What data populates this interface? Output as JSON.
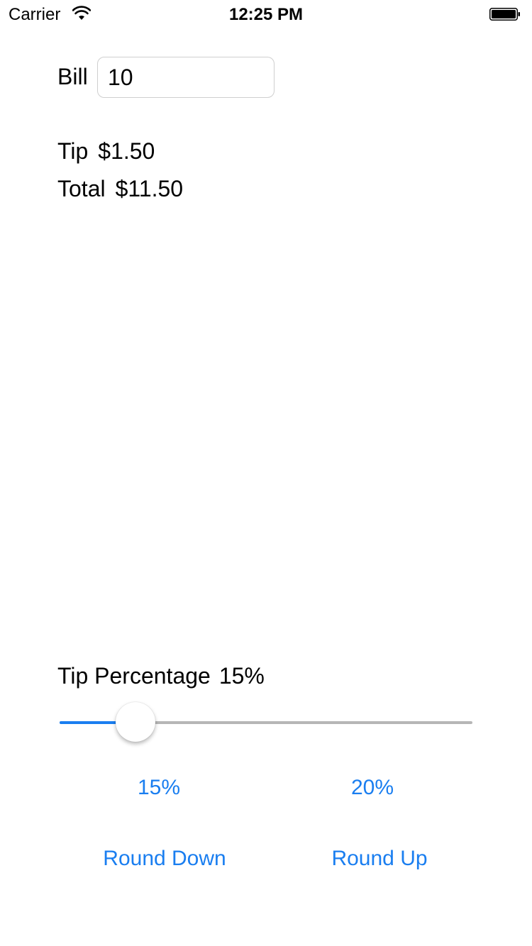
{
  "status_bar": {
    "carrier": "Carrier",
    "time": "12:25 PM"
  },
  "bill": {
    "label": "Bill",
    "value": "10"
  },
  "tip": {
    "label": "Tip",
    "value": "$1.50"
  },
  "total": {
    "label": "Total",
    "value": "$11.50"
  },
  "tip_percentage": {
    "label": "Tip Percentage",
    "value": "15%",
    "slider_fraction": 0.15
  },
  "presets": {
    "first": "15%",
    "second": "20%"
  },
  "rounding": {
    "down": "Round Down",
    "up": "Round Up"
  },
  "colors": {
    "accent": "#1a7ef0",
    "track": "#b6b6b6"
  },
  "icons": {
    "wifi": "wifi-icon",
    "battery": "battery-icon"
  }
}
